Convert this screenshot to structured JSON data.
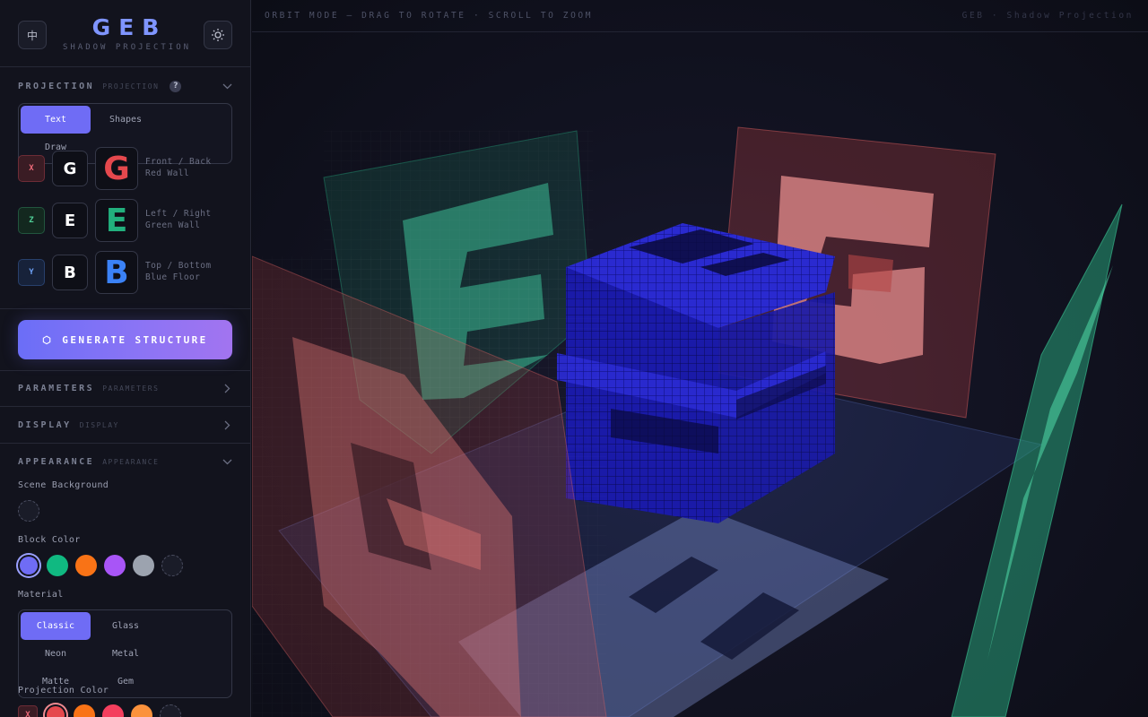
{
  "brand": {
    "title": "GEB",
    "subtitle": "SHADOW PROJECTION",
    "lang_label": "中"
  },
  "topbar": {
    "hint": "ORBIT MODE — DRAG TO ROTATE · SCROLL TO ZOOM",
    "breadcrumb": "GEB · Shadow Projection"
  },
  "projection": {
    "title": "PROJECTION",
    "subtitle": "PROJECTION",
    "help": "?",
    "modes": [
      "Text",
      "Shapes",
      "Draw"
    ],
    "active_mode": "Text",
    "rows": [
      {
        "axis": "X",
        "letter": "G",
        "preview": "G",
        "line1": "Front / Back",
        "line2": "Red Wall",
        "color": "#e5484d"
      },
      {
        "axis": "Z",
        "letter": "E",
        "preview": "E",
        "line1": "Left / Right",
        "line2": "Green Wall",
        "color": "#22b07d"
      },
      {
        "axis": "Y",
        "letter": "B",
        "preview": "B",
        "line1": "Top / Bottom",
        "line2": "Blue Floor",
        "color": "#3b82f6"
      }
    ]
  },
  "generate": {
    "icon": "⬡",
    "label": "GENERATE STRUCTURE"
  },
  "parameters": {
    "title": "PARAMETERS",
    "subtitle": "PARAMETERS"
  },
  "display": {
    "title": "DISPLAY",
    "subtitle": "DISPLAY"
  },
  "appearance": {
    "title": "APPEARANCE",
    "subtitle": "APPEARANCE",
    "scene_bg_label": "Scene Background",
    "block_color_label": "Block Color",
    "block_colors": [
      "#6f6cf5",
      "#10b981",
      "#f97316",
      "#a855f7",
      "#9ca3af"
    ],
    "material_label": "Material",
    "materials": [
      "Classic",
      "Glass",
      "Neon",
      "Metal",
      "Matte",
      "Gem"
    ],
    "active_material": "Classic",
    "projection_color_label": "Projection Color",
    "projection_axis": "X",
    "projection_colors": [
      "#e5484d",
      "#f97316",
      "#f43f5e",
      "#fb923c"
    ]
  },
  "colors": {
    "accent": "#6f6cf5",
    "brand": "#7f95ff"
  }
}
